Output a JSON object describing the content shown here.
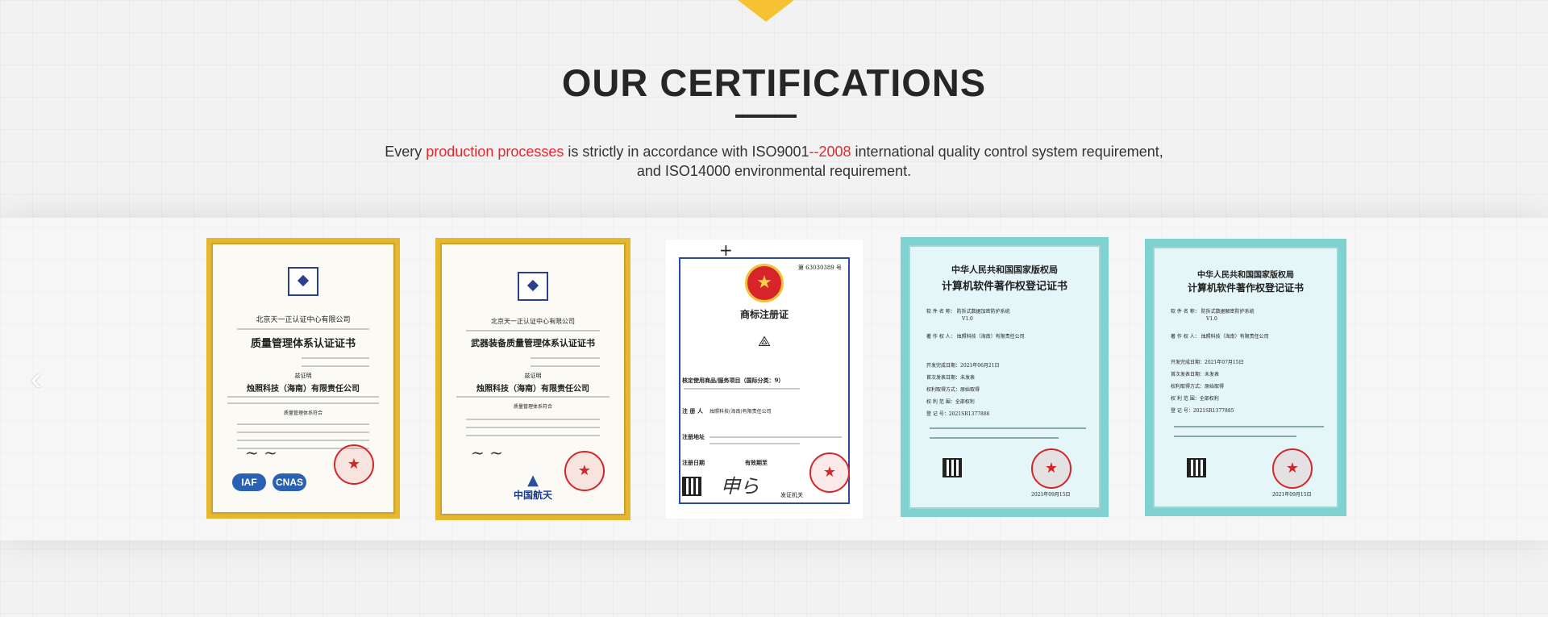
{
  "section": {
    "title": "OUR CERTIFICATIONS",
    "description": {
      "part1": "Every ",
      "highlight1": "production processes",
      "part2": " is strictly in accordance with ISO9001",
      "highlight2": "--2008",
      "part3": " international quality control system requirement,",
      "line2": "and ISO14000 environmental requirement."
    },
    "nav": {
      "prev_icon": "chevron-left-icon",
      "prev_glyph": "‹"
    },
    "accent_color": "#f7c232",
    "highlight_color": "#e8262b"
  },
  "certificates": [
    {
      "issuer": "北京天一正认证中心有限公司",
      "title": "质量管理体系认证证书",
      "section_label": "兹证明",
      "company": "烛照科技（海南）有限责任公司",
      "scope_label": "质量管理体系符合",
      "marks": [
        "IAF",
        "CNAS"
      ]
    },
    {
      "issuer": "北京天一正认证中心有限公司",
      "title": "武器装备质量管理体系认证证书",
      "section_label": "兹证明",
      "company": "烛照科技（海南）有限责任公司",
      "scope_label": "质量管理体系符合",
      "brand": "中国航天"
    },
    {
      "number_label": "第",
      "number": "63030389",
      "number_suffix": "号",
      "title": "商标注册证",
      "service_label": "核定使用商品/服务项目（国际分类：9）",
      "registrant_label": "注 册 人",
      "registrant": "烛照科技(海南)有限责任公司",
      "address_label": "注册地址",
      "date_label": "注册日期",
      "period_label": "有效期至",
      "issuer": "发证机关"
    },
    {
      "header": "中华人民共和国国家版权局",
      "title": "计算机软件著作权登记证书",
      "software_label": "软 件 名 称：",
      "software": "防拆式数据加密防护系统",
      "version": "V1.0",
      "owner_label": "著 作 权 人：",
      "owner": "烛照科技（海南）有限责任公司",
      "done_label": "开发完成日期：",
      "done": "2021年06月21日",
      "publish_label": "首次发表日期：",
      "publish": "未发表",
      "acquire_label": "权利取得方式：",
      "acquire": "原始取得",
      "scope_label": "权 利 范 围：",
      "scope": "全部权利",
      "reg_label": "登  记  号：",
      "reg": "2021SR1377886",
      "date": "2021年09月15日"
    },
    {
      "header": "中华人民共和国国家版权局",
      "title": "计算机软件著作权登记证书",
      "software_label": "软 件 名 称：",
      "software": "防拆式数据解密防护系统",
      "version": "V1.0",
      "owner_label": "著 作 权 人：",
      "owner": "烛照科技（海南）有限责任公司",
      "done_label": "开发完成日期：",
      "done": "2021年07月15日",
      "publish_label": "首次发表日期：",
      "publish": "未发表",
      "acquire_label": "权利取得方式：",
      "acquire": "原始取得",
      "scope_label": "权 利 范 围：",
      "scope": "全部权利",
      "reg_label": "登  记  号：",
      "reg": "2021SR1377885",
      "date": "2021年09月15日"
    }
  ]
}
